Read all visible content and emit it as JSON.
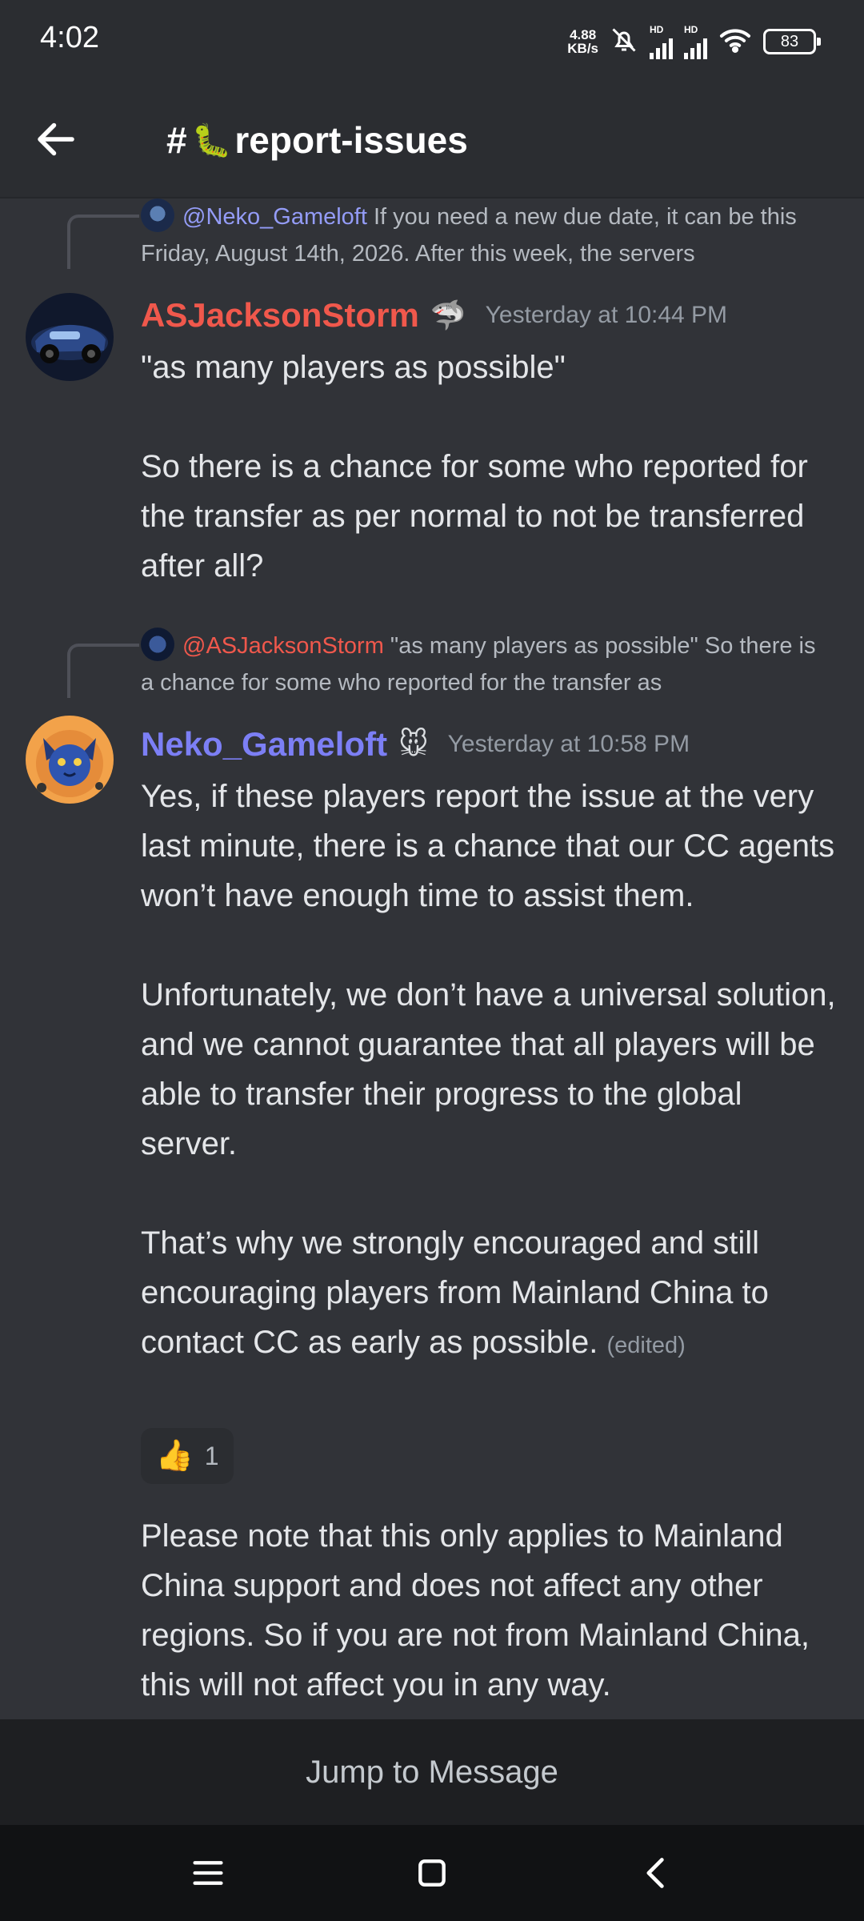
{
  "status_bar": {
    "time": "4:02",
    "net_speed_value": "4.88",
    "net_speed_unit": "KB/s",
    "signal_1_label": "HD",
    "signal_2_label": "HD",
    "battery": "83"
  },
  "header": {
    "hash": "#",
    "channel_emoji": "🐛",
    "channel_name": "report-issues"
  },
  "messages": [
    {
      "reply": {
        "mention": "@Neko_Gameloft",
        "text": " If you need a new due date, it can be this Friday, August 14th, 2026. After this week, the servers"
      },
      "author": "ASJacksonStorm",
      "author_color": "#f0584c",
      "badge": "🦈",
      "timestamp": "Yesterday at 10:44 PM",
      "body": "\"as many players as possible\"\n\nSo there is a chance for some who reported for the transfer as per normal to not be transferred after all?"
    },
    {
      "reply": {
        "mention": "@ASJacksonStorm",
        "text": " \"as many players as possible\"  So there is a chance for some who reported for the transfer as"
      },
      "author": "Neko_Gameloft",
      "author_color": "#7c7ff5",
      "badge": "🐭",
      "timestamp": "Yesterday at 10:58 PM",
      "body": "Yes, if these players report the issue at the very last minute, there is a chance that our CC agents won’t have enough time to assist them.\n\nUnfortunately, we don’t have a universal solution, and we cannot guarantee that all players will be able to transfer their progress to the global server.\n\nThat’s why we strongly encouraged and still encouraging players from Mainland China to contact CC as early as possible.",
      "edited": "(edited)",
      "reaction": {
        "emoji": "👍",
        "count": "1"
      },
      "followup": "Please note that this only applies to Mainland China support and does not affect any other regions. So if you are not from Mainland China, this will not affect you in any way."
    }
  ],
  "jump_to_message": "Jump to Message",
  "colors": {
    "background": "#313338",
    "header": "#2b2d31",
    "accent": "#949cf7"
  }
}
